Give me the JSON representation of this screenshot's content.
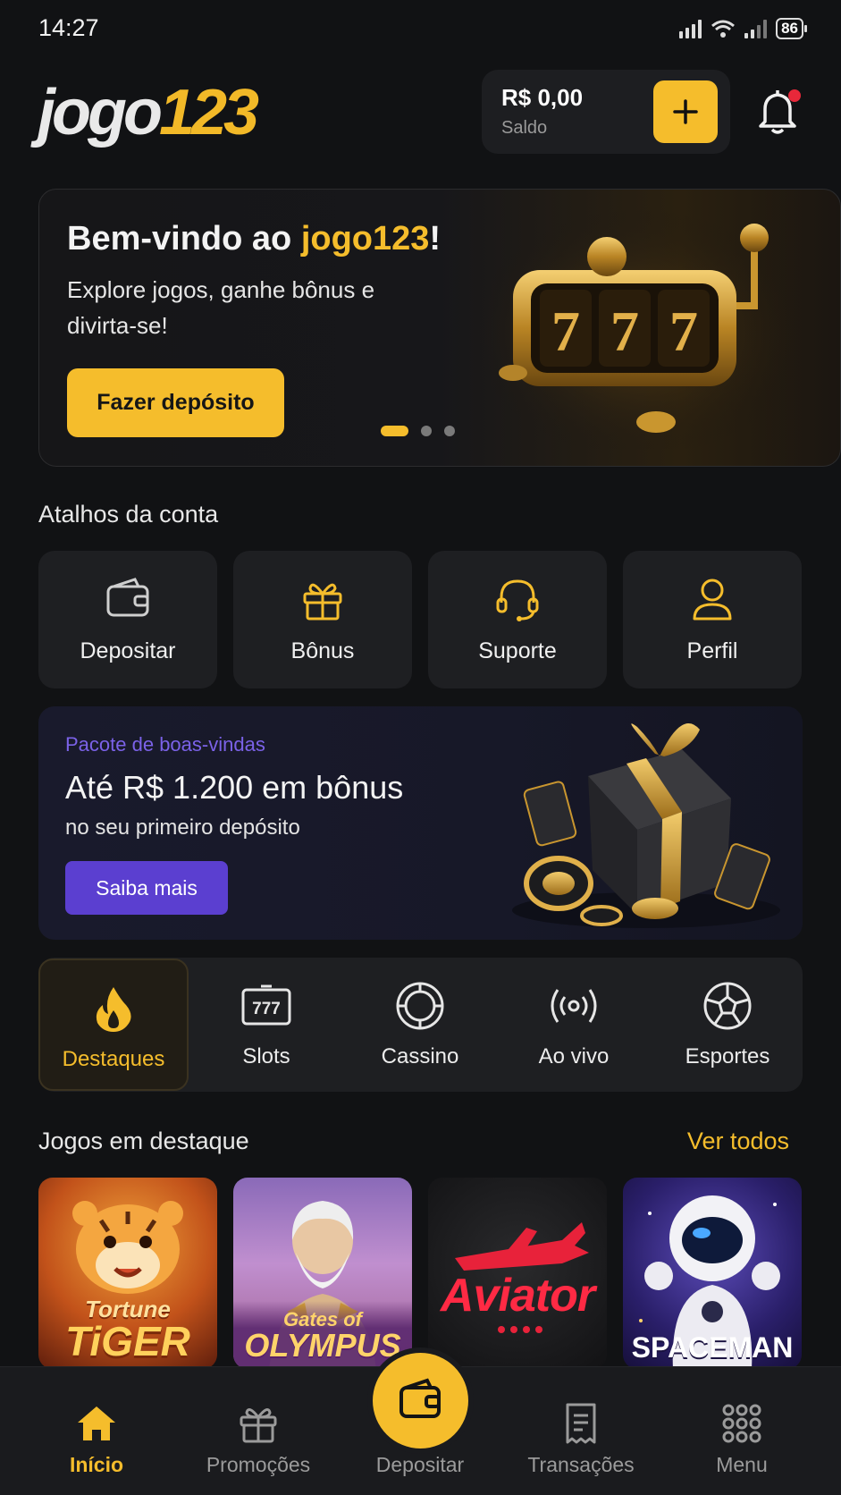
{
  "status_bar": {
    "time": "14:27",
    "battery": "86"
  },
  "header": {
    "logo_part1": "jogo",
    "logo_part2": "123",
    "balance": "R$ 0,00",
    "balance_label": "Saldo",
    "add_funds_icon": "plus-icon",
    "notification_icon": "bell-icon"
  },
  "hero": {
    "title_prefix": "Bem-vindo ao ",
    "title_brand": "jogo123",
    "title_suffix": "!",
    "subtitle": "Explore jogos, ganhe bônus e divirta-se!",
    "cta": "Fazer depósito",
    "slides": 3,
    "active_slide": 1
  },
  "shortcuts": {
    "title": "Atalhos da conta",
    "items": [
      {
        "label": "Depositar",
        "icon": "wallet-icon"
      },
      {
        "label": "Bônus",
        "icon": "gift-icon"
      },
      {
        "label": "Suporte",
        "icon": "headset-icon"
      },
      {
        "label": "Perfil",
        "icon": "user-icon"
      }
    ]
  },
  "promo": {
    "tag": "Pacote de boas-vindas",
    "headline": "Até R$ 1.200 em bônus",
    "description": "no seu primeiro depósito",
    "button": "Saiba mais"
  },
  "categories": [
    {
      "label": "Destaques",
      "icon": "flame-icon",
      "active": true
    },
    {
      "label": "Slots",
      "icon": "slot-777-icon",
      "active": false
    },
    {
      "label": "Cassino",
      "icon": "chip-icon",
      "active": false
    },
    {
      "label": "Ao vivo",
      "icon": "live-broadcast-icon",
      "active": false
    },
    {
      "label": "Esportes",
      "icon": "soccer-ball-icon",
      "active": false
    }
  ],
  "featured": {
    "title": "Jogos em destaque",
    "see_all": "Ver todos",
    "games": [
      {
        "title_line1": "Tortune",
        "title_line2": "TiGER"
      },
      {
        "title_line1": "Gates of",
        "title_line2": "OLYMPUS"
      },
      {
        "title_line1": "Aviator",
        "title_line2": ""
      },
      {
        "title_line1": "SPACEMAN",
        "title_line2": ""
      }
    ]
  },
  "bottom_nav": [
    {
      "label": "Início",
      "icon": "home-icon",
      "active": true
    },
    {
      "label": "Promoções",
      "icon": "gift-icon",
      "active": false
    },
    {
      "label": "Depositar",
      "icon": "wallet-icon",
      "active": false
    },
    {
      "label": "Transações",
      "icon": "receipt-icon",
      "active": false
    },
    {
      "label": "Menu",
      "icon": "grid-icon",
      "active": false
    }
  ],
  "colors": {
    "accent": "#f5bd2c",
    "promo_accent": "#5b3fd0",
    "background": "#111214",
    "card": "#1e1f22"
  }
}
